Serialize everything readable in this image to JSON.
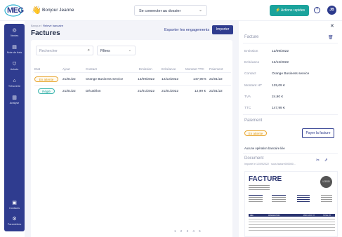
{
  "header": {
    "logo": "MEG",
    "greeting": "Bonjour Jeanne",
    "dossier_placeholder": "Se connecter au dossier",
    "quick_actions": "Actions rapides",
    "avatar_initials": "JB"
  },
  "sidebar": {
    "items": [
      {
        "label": "Ventes",
        "icon": "coins-icon"
      },
      {
        "label": "Note de frais",
        "icon": "receipt-icon"
      },
      {
        "label": "Achats",
        "icon": "bag-icon"
      },
      {
        "label": "Trésorerie",
        "icon": "bank-icon"
      },
      {
        "label": "Analyse",
        "icon": "chart-icon"
      }
    ],
    "bottom_items": [
      {
        "label": "Contacts",
        "icon": "contacts-icon"
      },
      {
        "label": "Paramètres",
        "icon": "gear-icon"
      }
    ]
  },
  "main": {
    "breadcrumb": {
      "root": "Banque",
      "current": "Relevé bancaire"
    },
    "title": "Factures",
    "export_label": "Exporter les engagements",
    "import_label": "Importer",
    "search_placeholder": "Rechercher",
    "filter_label": "Filtres",
    "columns": [
      "Etat",
      "Ajout",
      "Contact",
      "Emission",
      "Echéance",
      "Montant TTC",
      "Paiement"
    ],
    "rows": [
      {
        "status": "En attente",
        "status_type": "pending",
        "added": "21/01/22",
        "contact": "Orange Business service",
        "emission": "12/09/2022",
        "due": "12/12/2022",
        "amount": "147,99 €",
        "payment": "21/01/22"
      },
      {
        "status": "Réglé",
        "status_type": "paid",
        "added": "21/01/22",
        "contact": "Décathlon",
        "emission": "21/01/2022",
        "due": "21/01/2022",
        "amount": "12,99 €",
        "payment": "21/01/22"
      }
    ],
    "pagination": [
      "1",
      "2",
      "3",
      "4",
      "5"
    ]
  },
  "panel": {
    "invoice_section": "Facture",
    "fields": [
      {
        "key": "Emission",
        "value": "12/09/2022"
      },
      {
        "key": "Echéance",
        "value": "12/12/2022"
      },
      {
        "key": "Contact",
        "value": "Orange Business service"
      },
      {
        "key": "Montant HT",
        "value": "125,09 €"
      },
      {
        "key": "TVA",
        "value": "24,90 €"
      },
      {
        "key": "TTC",
        "value": "147,99 €"
      }
    ],
    "payment_section": "Paiement",
    "payment_status": "En attente",
    "pay_button": "Payer la facture",
    "no_operation": "Aucune opération bancaire liée",
    "document_section": "Document",
    "document_sub": "Importé le 12/09/2022 · sous facture000000...",
    "preview": {
      "title": "FACTURE",
      "logo": "LOGO",
      "col_labels": [
        "RÉF.",
        "DÉSIGNATION",
        "PRIX UNIT. HT",
        "TOTAL HT"
      ]
    }
  },
  "colors": {
    "brand": "#2f3c8f",
    "accent": "#1ba39c",
    "pending": "#e8a630"
  }
}
